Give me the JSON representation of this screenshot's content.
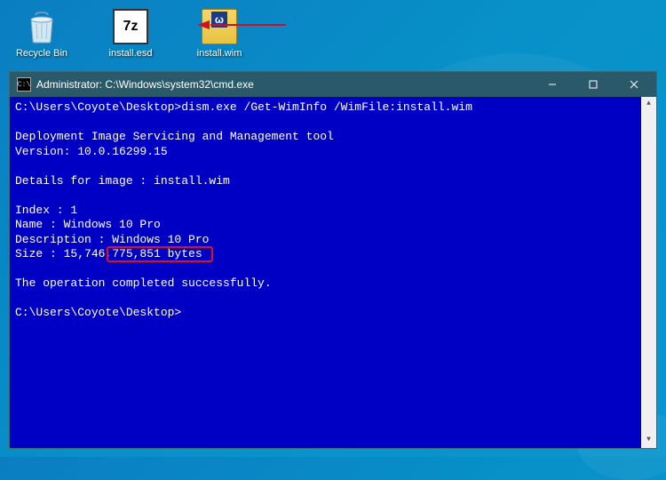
{
  "desktop": {
    "icons": [
      {
        "label": "Recycle Bin"
      },
      {
        "label": "install.esd"
      },
      {
        "label": "install.wim"
      }
    ]
  },
  "cmd": {
    "title": "Administrator: C:\\Windows\\system32\\cmd.exe",
    "icon_text": "C:\\",
    "prompt1": "C:\\Users\\Coyote\\Desktop>",
    "command": "dism.exe /Get-WimInfo /WimFile:install.wim",
    "line_tool": "Deployment Image Servicing and Management tool",
    "line_version": "Version: 10.0.16299.15",
    "line_details": "Details for image : install.wim",
    "line_index": "Index : 1",
    "line_name": "Name : Windows 10 Pro",
    "line_desc_label": "Description : ",
    "line_desc_value": "Windows 10 Pro",
    "line_size": "Size : 15,746,775,851 bytes",
    "line_success": "The operation completed successfully.",
    "prompt2": "C:\\Users\\Coyote\\Desktop>"
  },
  "controls": {
    "minimize": "—",
    "maximize": "□",
    "close": "✕"
  }
}
